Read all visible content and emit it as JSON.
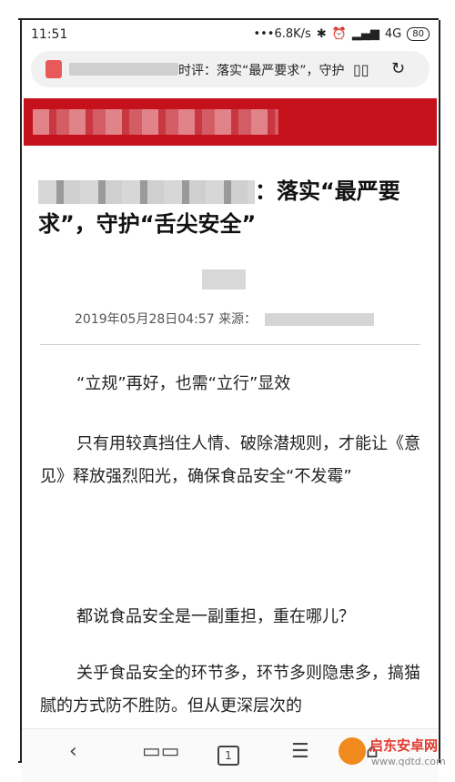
{
  "status": {
    "time": "11:51",
    "network": "•••6.8K/s",
    "signal": "4G",
    "battery": "80"
  },
  "urlbar": {
    "title_text": "时评：落实“最严要求”，守护"
  },
  "article": {
    "title_suffix": "：落实“最严要求”，守护“舌尖安全”",
    "date": "2019年05月28日04:57",
    "source_label": "来源：",
    "paragraphs": [
      "“立规”再好，也需“立行”显效",
      "只有用较真挡住人情、破除潜规则，才能让《意见》释放强烈阳光，确保食品安全“不发霉”",
      "都说食品安全是一副重担，重在哪儿？",
      "关乎食品安全的环节多，环节多则隐患多，搞猫腻的方式防不胜防。但从更深层次的"
    ]
  },
  "nav": {
    "back": "‹",
    "bookmarks": "📖",
    "tabs_count": "1",
    "menu": "☰",
    "home": "⌂"
  },
  "watermark": {
    "name": "启东安卓网",
    "url": "www.qdtd.com"
  }
}
